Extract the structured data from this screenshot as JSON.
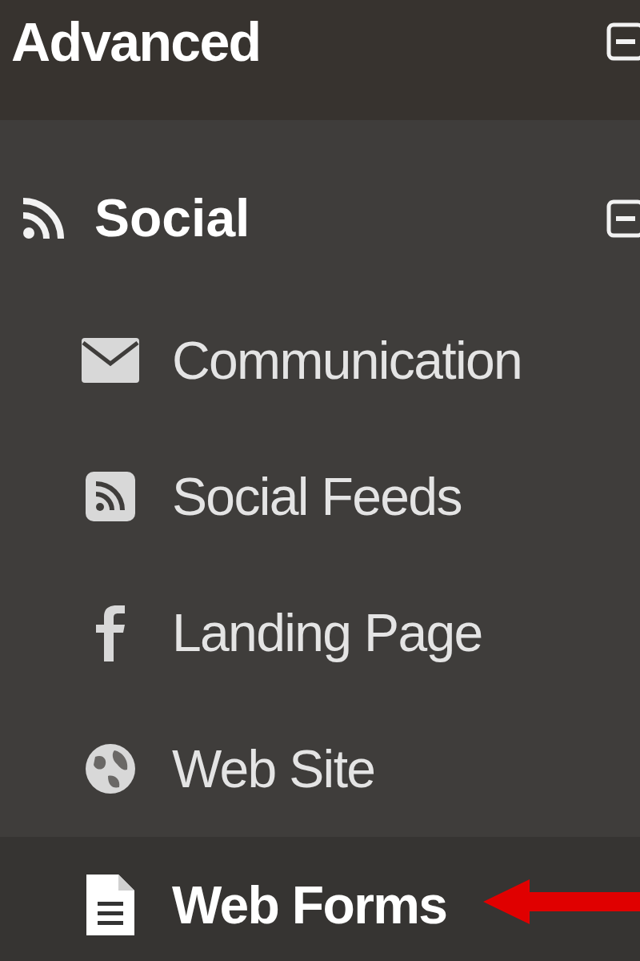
{
  "header": {
    "title": "Advanced",
    "expanded": true
  },
  "group": {
    "label": "Social",
    "expanded": true,
    "items": [
      {
        "label": "Communication",
        "kind": "mail",
        "selected": false
      },
      {
        "label": "Social Feeds",
        "kind": "feed",
        "selected": false
      },
      {
        "label": "Landing Page",
        "kind": "facebook",
        "selected": false
      },
      {
        "label": "Web Site",
        "kind": "globe",
        "selected": false
      },
      {
        "label": "Web Forms",
        "kind": "document",
        "selected": true
      }
    ]
  }
}
